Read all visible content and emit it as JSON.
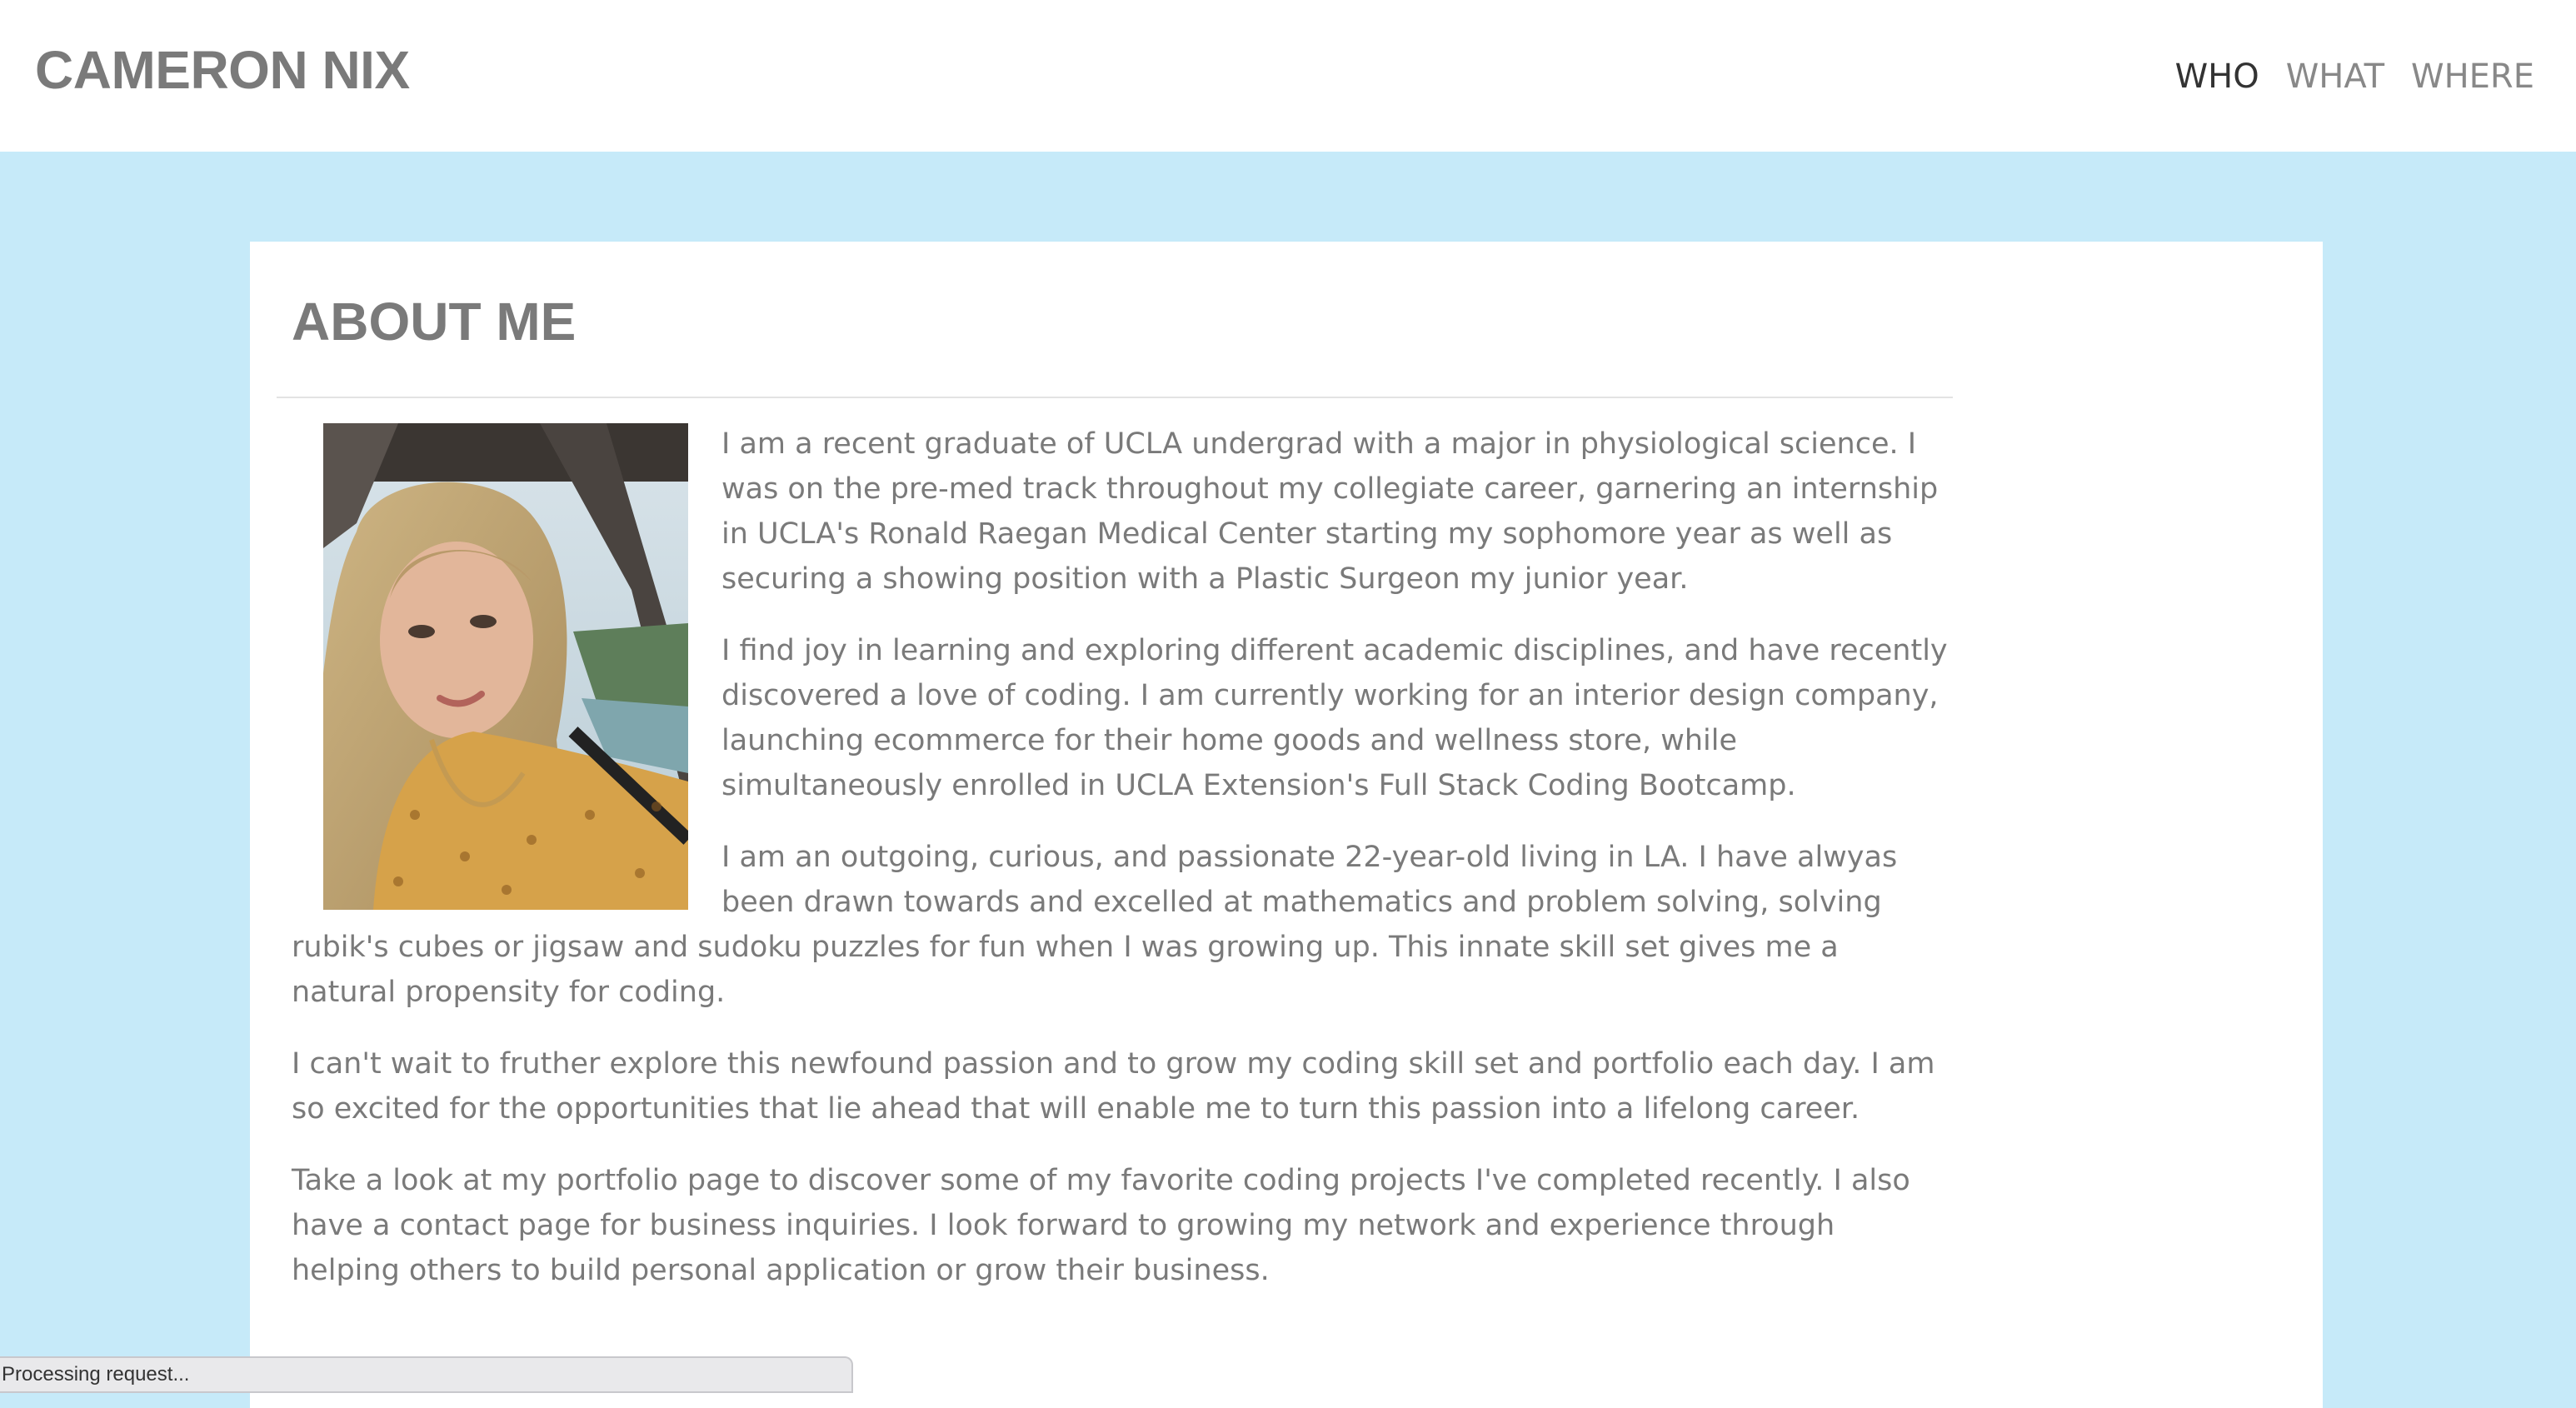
{
  "header": {
    "site_title": "CAMERON NIX",
    "nav": [
      {
        "label": "WHO",
        "active": true
      },
      {
        "label": "WHAT",
        "active": false
      },
      {
        "label": "WHERE",
        "active": false
      }
    ]
  },
  "about": {
    "title": "ABOUT ME",
    "paragraphs": [
      "I am a recent graduate of UCLA undergrad with a major in physiological science. I was on the pre-med track throughout my collegiate career, garnering an internship in UCLA's Ronald Raegan Medical Center starting my sophomore year as well as securing a showing position with a Plastic Surgeon my junior year.",
      "I find joy in learning and exploring different academic disciplines, and have recently discovered a love of coding. I am currently working for an interior design company, launching ecommerce for their home goods and wellness store, while simultaneously enrolled in UCLA Extension's Full Stack Coding Bootcamp.",
      "I am an outgoing, curious, and passionate 22-year-old living in LA. I have alwyas been drawn towards and excelled at mathematics and problem solving, solving rubik's cubes or jigsaw and sudoku puzzles for fun when I was growing up. This innate skill set gives me a natural propensity for coding.",
      "I can't wait to fruther explore this newfound passion and to grow my coding skill set and portfolio each day. I am so excited for the opportunities that lie ahead that will enable me to turn this passion into a lifelong career.",
      "Take a look at my portfolio page to discover some of my favorite coding projects I've completed recently. I also have a contact page for business inquiries. I look forward to growing my network and experience through helping others to build personal application or grow their business."
    ]
  },
  "status_bar": {
    "text": "Processing request..."
  },
  "colors": {
    "page_background": "#c6eaf9",
    "text": "#7a7a7a",
    "nav_active": "#333333"
  }
}
